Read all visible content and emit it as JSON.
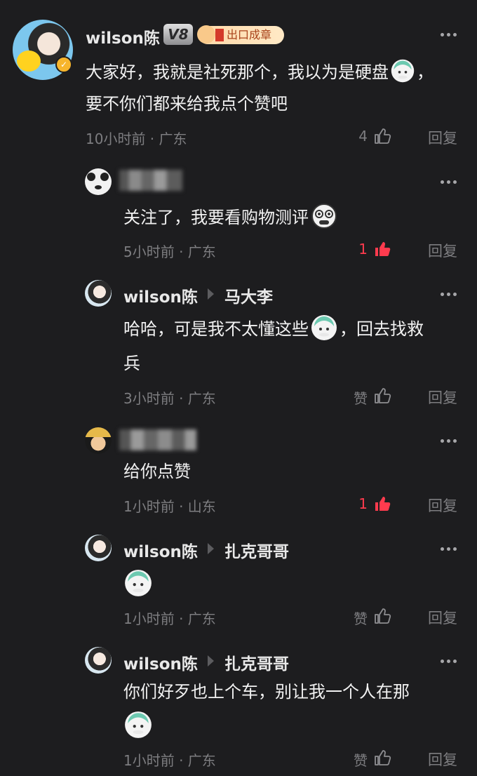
{
  "colors": {
    "background": "#1d1d1f",
    "name": "#e8e8e8",
    "text": "#f2f2f2",
    "meta": "#7d7d80",
    "liked": "#ff3b4e"
  },
  "comments": [
    {
      "username": "wilson陈",
      "level_badge": "V8",
      "honor_badge": "出口成章",
      "text_line1": "大家好，我就是社死那个，我以为是硬盘",
      "text_line1_end": "，",
      "text_line2": "要不你们都来给我点个赞吧",
      "time": "10小时前 · 广东",
      "likes": "4",
      "reply": "回复"
    },
    {
      "text": "关注了，我要看购物测评",
      "time": "5小时前 · 广东",
      "likes": "1",
      "liked": true,
      "reply": "回复"
    },
    {
      "username": "wilson陈",
      "reply_to": "马大李",
      "text_line1": "哈哈，可是我不太懂这些",
      "text_line1_end": "，回去找救",
      "text_line2": "兵",
      "time": "3小时前 · 广东",
      "likes": "赞",
      "reply": "回复"
    },
    {
      "text": "给你点赞",
      "time": "1小时前 · 山东",
      "likes": "1",
      "liked": true,
      "reply": "回复"
    },
    {
      "username": "wilson陈",
      "reply_to": "扎克哥哥",
      "time": "1小时前 · 广东",
      "likes": "赞",
      "reply": "回复"
    },
    {
      "username": "wilson陈",
      "reply_to": "扎克哥哥",
      "text_line1": "你们好歹也上个车，别让我一个人在那",
      "time": "1小时前 · 广东",
      "likes": "赞",
      "reply": "回复"
    }
  ]
}
